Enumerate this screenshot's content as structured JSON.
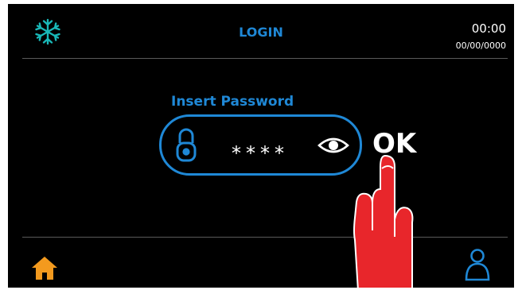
{
  "header": {
    "title": "LOGIN",
    "time": "00:00",
    "date": "00/00/0000",
    "mode_icon": "snowflake-icon"
  },
  "login": {
    "prompt": "Insert Password",
    "password_masked": "****",
    "lock_icon": "lock-icon",
    "visibility_icon": "eye-icon",
    "ok_label": "OK"
  },
  "footer": {
    "home_icon": "home-icon",
    "user_icon": "user-icon"
  },
  "overlay": {
    "pointer_icon": "hand-pointer-icon"
  },
  "colors": {
    "background": "#000000",
    "accent_blue": "#1f88d6",
    "snowflake_teal": "#19b8b8",
    "home_orange": "#f39a1e",
    "hand_red": "#e8262b"
  }
}
